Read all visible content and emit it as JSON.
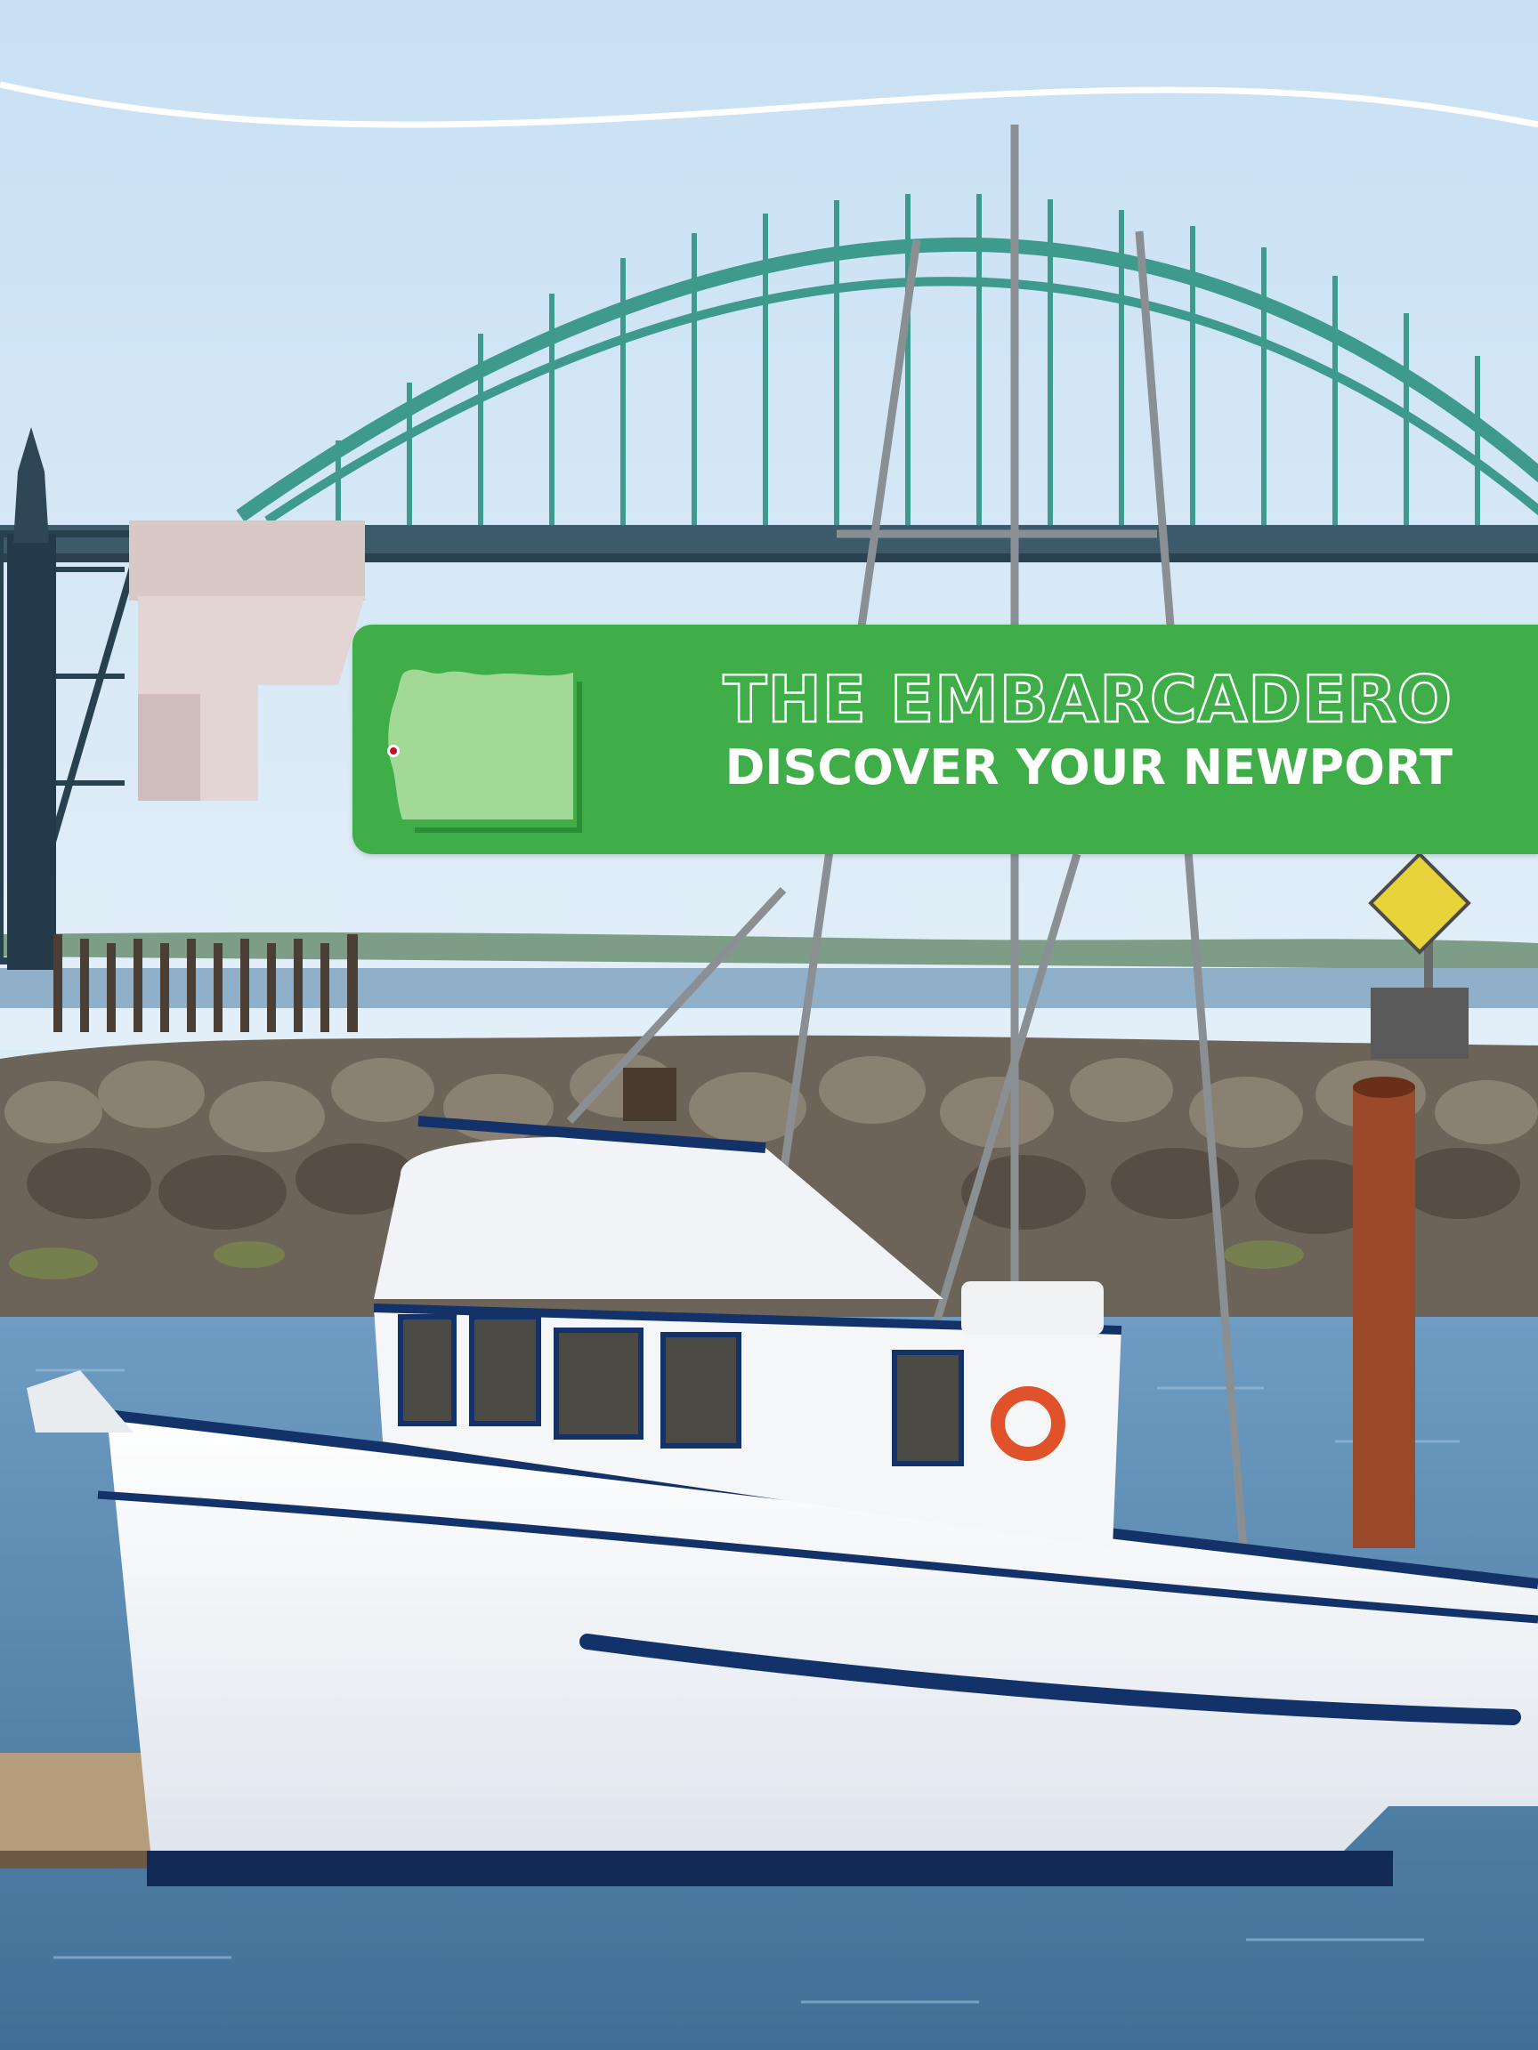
{
  "banner": {
    "title": "THE EMBARCADERO",
    "subtitle": "DISCOVER YOUR NEWPORT"
  },
  "colors": {
    "banner_green": "#3fae49",
    "map_green": "#9fd48f",
    "bridge_teal": "#3f9a8e",
    "sky": "#d9ebf7",
    "water": "#4f7fa6",
    "boat_white": "#f4f6f8",
    "boat_trim": "#14326a",
    "marker_red": "#c8102e"
  },
  "icons": [
    "oregon-state-map-icon",
    "location-marker-icon",
    "diamond-road-sign-icon",
    "life-ring-icon"
  ]
}
